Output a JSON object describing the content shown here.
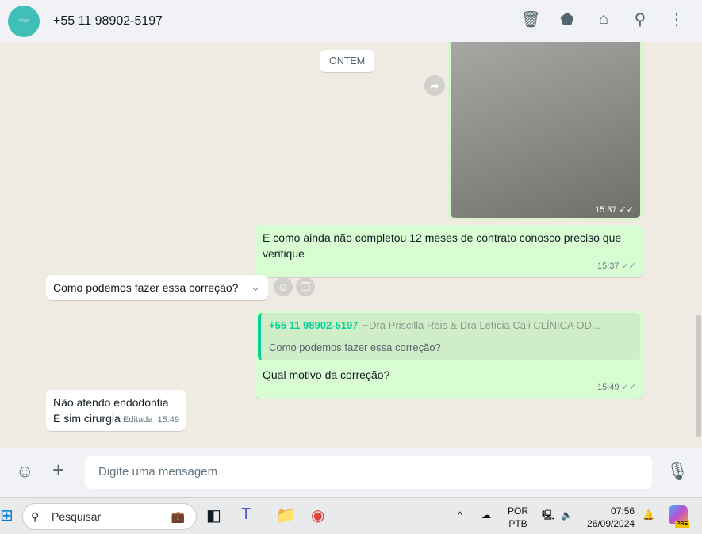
{
  "header": {
    "avatar_text": "PRDI",
    "title": "+55 11 98902-5197",
    "icons": [
      "delete-icon",
      "label-icon",
      "store-icon",
      "search-icon",
      "menu-icon"
    ]
  },
  "chat": {
    "date": "ONTEM",
    "image_msg": {
      "time": "15:37"
    },
    "messages": [
      {
        "dir": "out",
        "text": "E como ainda não completou 12 meses de contrato conosco preciso que verifique",
        "time": "15:37"
      },
      {
        "dir": "in",
        "text": "Como podemos fazer essa correção?"
      },
      {
        "dir": "out",
        "quote_name": "+55 11 98902-5197",
        "quote_sub": "~Dra Priscilla Reis & Dra Letícia Cali CLÍNICA OD...",
        "quote_text": "Como podemos fazer essa correção?",
        "text": "Qual motivo da correção?",
        "time": "15:49"
      },
      {
        "dir": "in",
        "line1": "Não atendo endodontia",
        "line2": "E sim cirurgia",
        "edited": "Editada",
        "time": "15:49"
      }
    ]
  },
  "footer": {
    "placeholder": "Digite uma mensagem"
  },
  "taskbar": {
    "search": "Pesquisar",
    "lang1": "POR",
    "lang2": "PTB",
    "time": "07:56",
    "date": "26/09/2024",
    "copilot_badge": "PRE"
  }
}
